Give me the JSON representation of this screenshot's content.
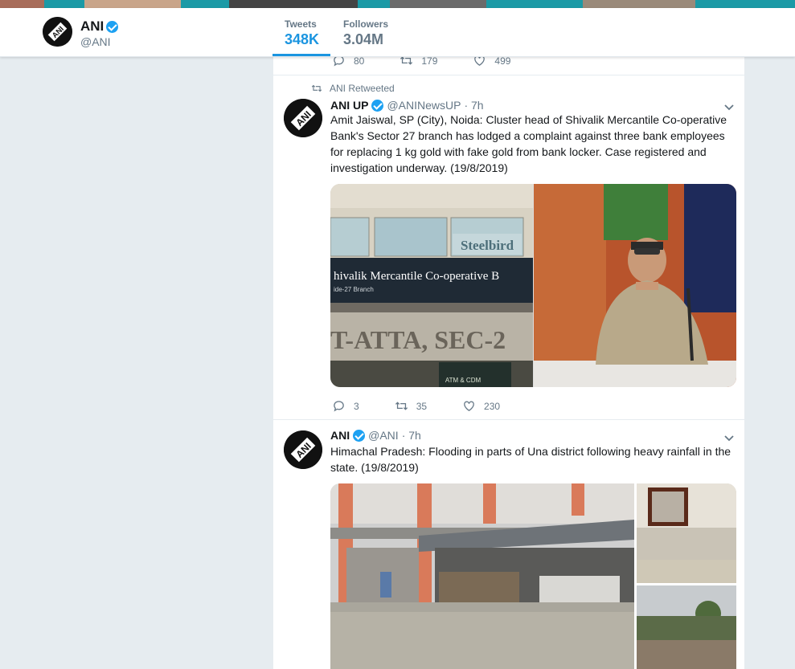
{
  "profile": {
    "name": "ANI",
    "handle": "@ANI",
    "stats": [
      {
        "label": "Tweets",
        "value": "348K"
      },
      {
        "label": "Followers",
        "value": "3.04M"
      }
    ]
  },
  "tweets": [
    {
      "reply_count": "80",
      "retweet_count": "179",
      "like_count": "499"
    },
    {
      "context": "ANI Retweeted",
      "name": "ANI UP",
      "handle": "@ANINewsUP",
      "time": "· 7h",
      "text_lines": [
        "Amit Jaiswal, SP (City), Noida: Cluster head of Shivalik Mercantile Co-operative",
        "Bank's Sector 27 branch has lodged a complaint against three bank employees",
        "for replacing 1 kg gold with fake gold from bank locker. Case registered and",
        "investigation underway. (19/8/2019)"
      ],
      "media_sign_text": "hivalik Mercantile Co-operative B",
      "media_sign_branch": "ide-27 Branch",
      "media_sign_lower": "T-ATTA, SEC-2",
      "media_sign_steelbird": "Steelbird",
      "media_atm": "ATM & CDM",
      "reply_count": "3",
      "retweet_count": "35",
      "like_count": "230"
    },
    {
      "name": "ANI",
      "handle": "@ANI",
      "time": "· 7h",
      "text_lines": [
        "Himachal Pradesh: Flooding in parts of Una district following heavy rainfall in the",
        "state. (19/8/2019)"
      ]
    }
  ],
  "icons": [
    "reply-icon",
    "retweet-icon",
    "like-icon",
    "verified-icon",
    "chevron-down-icon"
  ],
  "colors": {
    "accent": "#1b95e0",
    "verified": "#1da1f2",
    "muted": "#657786"
  }
}
